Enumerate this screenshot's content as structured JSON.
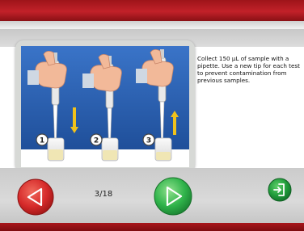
{
  "instructions": {
    "text": "Collect 150 µL of sample with a pipette. Use a new tip for each test to prevent contamination from previous samples."
  },
  "illustration": {
    "steps": [
      "1",
      "2",
      "3"
    ],
    "background_color": "#2a62b8",
    "arrow_color": "#f1c21b"
  },
  "navigation": {
    "page_counter": "3/18",
    "prev_icon": "left-triangle-icon",
    "next_icon": "right-triangle-icon",
    "exit_icon": "exit-door-icon"
  },
  "colors": {
    "header_red": "#c22129",
    "prev_red": "#d62a2a",
    "next_green": "#2fb34a",
    "exit_green": "#1f9a3a"
  }
}
